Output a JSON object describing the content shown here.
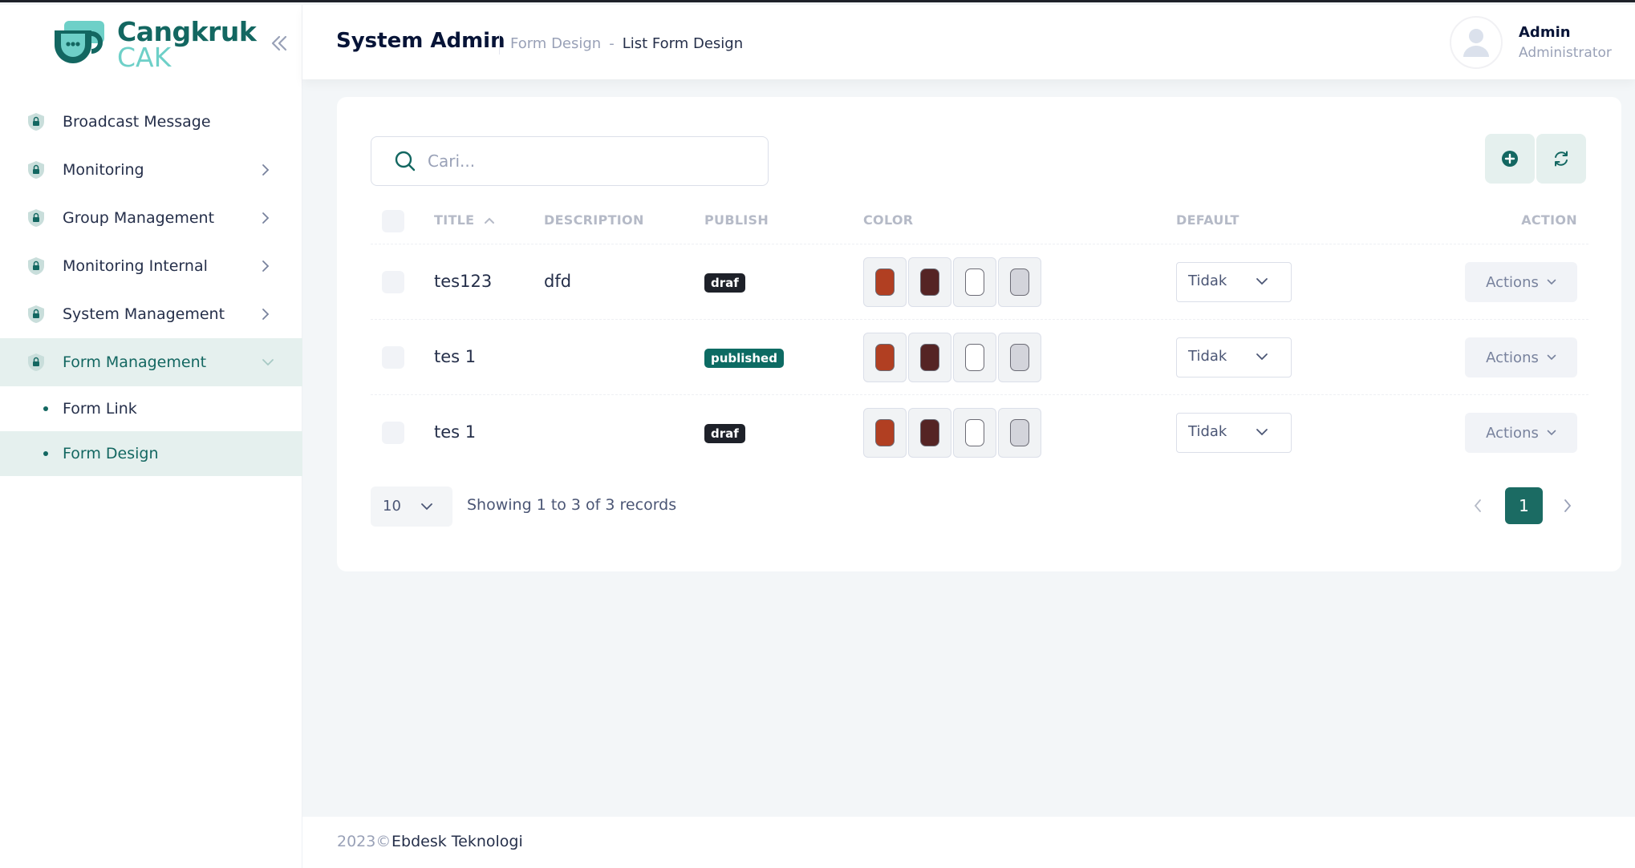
{
  "brand": {
    "line1": "Cangkruk",
    "line2": "CAK"
  },
  "sidebar": {
    "items": [
      {
        "label": "Broadcast Message"
      },
      {
        "label": "Monitoring"
      },
      {
        "label": "Group Management"
      },
      {
        "label": "Monitoring Internal"
      },
      {
        "label": "System Management"
      },
      {
        "label": "Form Management"
      }
    ],
    "subitems": [
      {
        "label": "Form Link"
      },
      {
        "label": "Form Design"
      }
    ]
  },
  "header": {
    "title": "System Admin",
    "breadcrumb": {
      "parent": "Form Design",
      "sep": "-",
      "current": "List Form Design"
    },
    "user": {
      "name": "Admin",
      "role": "Administrator"
    }
  },
  "search": {
    "placeholder": "Cari..."
  },
  "table": {
    "headers": {
      "title": "TITLE",
      "description": "DESCRIPTION",
      "publish": "PUBLISH",
      "color": "COLOR",
      "default": "DEFAULT",
      "action": "ACTION"
    },
    "rows": [
      {
        "title": "tes123",
        "description": "dfd",
        "publish": "draf",
        "default": "Tidak",
        "action": "Actions"
      },
      {
        "title": "tes 1",
        "description": "",
        "publish": "published",
        "default": "Tidak",
        "action": "Actions"
      },
      {
        "title": "tes 1",
        "description": "",
        "publish": "draf",
        "default": "Tidak",
        "action": "Actions"
      }
    ],
    "swatch_colors": [
      "#b13f22",
      "#552424",
      "#ffffff",
      "#d3d4db"
    ]
  },
  "pagination": {
    "page_size": "10",
    "info": "Showing 1 to 3 of 3 records",
    "current": "1"
  },
  "footer": {
    "year": "2023©",
    "company": "Ebdesk Teknologi"
  },
  "colors": {
    "accent": "#136761",
    "active_bg": "#e5f0ee",
    "draft_badge": "#1e2129",
    "published_badge": "#0d6b63"
  }
}
